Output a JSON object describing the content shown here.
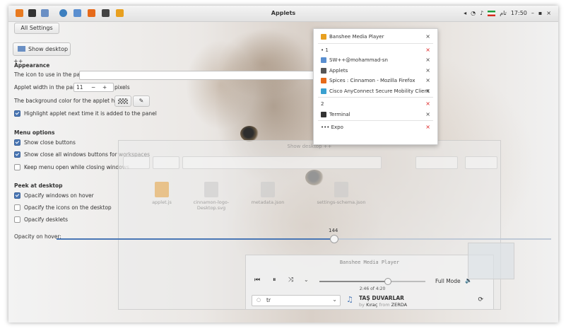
{
  "topbar": {
    "title": "Applets",
    "tray_locale": "تام",
    "tray_time": "17:50",
    "tray_minimize": "–",
    "tray_maximize": "▪",
    "tray_close": "×"
  },
  "settings": {
    "all_settings_button": "All Settings",
    "applet_button": "Show desktop ++",
    "appearance": {
      "heading": "Appearance",
      "icon_label": "The icon to use in the panel:",
      "width_label": "Applet width in the panel:",
      "width_value": "11",
      "width_minus": "−",
      "width_plus": "+",
      "width_unit": "pixels",
      "bg_color_label": "The background color for the applet hover:",
      "highlight_label": "Highlight applet next time it is added to the panel",
      "highlight_checked": true
    },
    "menu_options": {
      "heading": "Menu options",
      "show_close": "Show close buttons",
      "show_close_checked": true,
      "show_close_all": "Show close all windows buttons for workspaces",
      "show_close_all_checked": true,
      "keep_open": "Keep menu open while closing windows",
      "keep_open_checked": false
    },
    "peek": {
      "heading": "Peek at desktop",
      "opacify_windows": "Opacify windows on hover",
      "opacify_windows_checked": true,
      "opacify_icons": "Opacify the icons on the desktop",
      "opacify_icons_checked": false,
      "opacify_desklets": "Opacify desklets",
      "opacify_desklets_checked": false,
      "opacity_label": "Opacity on hover:",
      "opacity_value": "144",
      "opacity_fraction": 0.56
    }
  },
  "file_manager": {
    "title": "Show desktop ++",
    "files": [
      {
        "name": "applet.js",
        "icon": "js-file-icon"
      },
      {
        "name": "cinnamon-logo-Desktop.svg",
        "icon": "image-file-icon"
      },
      {
        "name": "metadata.json",
        "icon": "json-file-icon"
      },
      {
        "name": "settings-schema.json",
        "icon": "json-file-icon"
      }
    ]
  },
  "banshee": {
    "title": "Banshee Media Player",
    "elapsed": "2:46 of 4:20",
    "progress_fraction": 0.64,
    "full_mode": "Full Mode",
    "source": "tr",
    "track_title": "TAŞ DUVARLAR",
    "track_sub_by": "by",
    "track_artist": "Kıraç",
    "track_sub_from": "from",
    "track_album": "ZERDA"
  },
  "window_list": {
    "items": [
      {
        "kind": "window",
        "label": "Banshee Media Player",
        "icon": "banshee-icon",
        "icon_color": "#e8a020",
        "close": "×",
        "close_red": false
      },
      {
        "kind": "workspace",
        "label": "• 1",
        "close": "×",
        "close_red": true
      },
      {
        "kind": "window",
        "label": "SW++@mohammad-sn",
        "icon": "folder-icon",
        "icon_color": "#5a8fd0",
        "close": "×",
        "close_red": false
      },
      {
        "kind": "window",
        "label": "Applets",
        "icon": "applets-icon",
        "icon_color": "#555555",
        "close": "×",
        "close_red": false
      },
      {
        "kind": "window",
        "label": "Spices : Cinnamon - Mozilla Firefox",
        "icon": "firefox-icon",
        "icon_color": "#e66a1a",
        "close": "×",
        "close_red": false
      },
      {
        "kind": "window",
        "label": "Cisco AnyConnect Secure Mobility Client",
        "icon": "cisco-icon",
        "icon_color": "#3aa0d0",
        "close": "×",
        "close_red": false
      },
      {
        "kind": "workspace",
        "label": "2",
        "close": "×",
        "close_red": true
      },
      {
        "kind": "window",
        "label": "Terminal",
        "icon": "terminal-icon",
        "icon_color": "#333333",
        "close": "×",
        "close_red": false
      },
      {
        "kind": "workspace",
        "label": "••• Expo",
        "close": "×",
        "close_red": true
      }
    ]
  },
  "colors": {
    "accent": "#4a77b5",
    "close_red": "#d22222"
  }
}
